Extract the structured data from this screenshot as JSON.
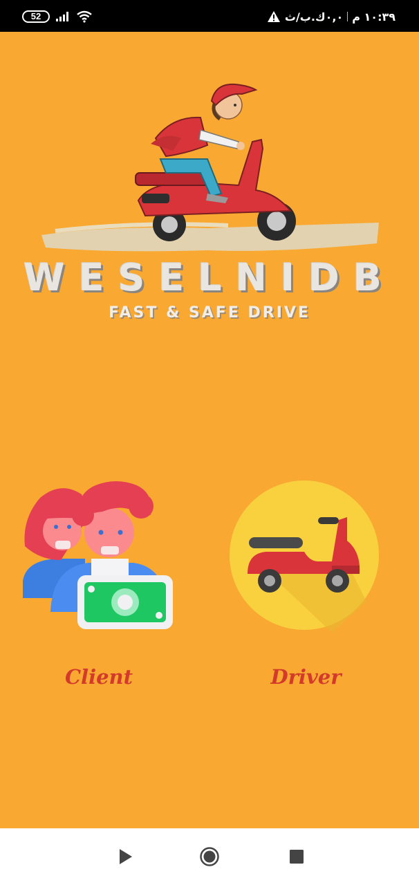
{
  "status_bar": {
    "battery": "52",
    "time": "١٠:٣٩ م",
    "network_speed": "٠,٠ك.ب/ث",
    "icons": [
      "signal-icon",
      "wifi-icon",
      "warning-icon"
    ]
  },
  "logo": {
    "brand": "WESELNIDB",
    "tagline": "FAST & SAFE DRIVE"
  },
  "roles": {
    "client_label": "Client",
    "driver_label": "Driver"
  },
  "nav_bar": {
    "icons": [
      "back-icon",
      "home-icon",
      "recents-icon"
    ]
  },
  "colors": {
    "background": "#F9A932",
    "accent_red": "#D33A2C",
    "scooter_red": "#D8343A",
    "driver_circle": "#F9D13F",
    "money_green": "#1FC763"
  }
}
